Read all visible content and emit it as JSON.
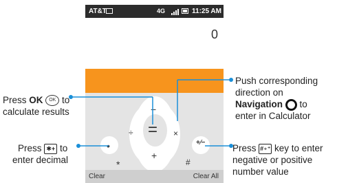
{
  "statusbar": {
    "carrier": "AT&T",
    "network": "4G",
    "time": "11:25 AM"
  },
  "display": {
    "value": "0"
  },
  "keypad": {
    "equals": "=",
    "minus": "−",
    "plus": "+",
    "divide": "÷",
    "multiply": "×",
    "dot": "•",
    "sign": "+∕−",
    "star": "*",
    "hash": "#",
    "soft_left": "Clear",
    "soft_right": "Clear All"
  },
  "callouts": {
    "ok": {
      "pre": "Press ",
      "key": "OK",
      "icon": "OK",
      "post": " to",
      "line2": "calculate results"
    },
    "decimal": {
      "pre": "Press ",
      "icon": "✱+",
      "post": " to",
      "line2": "enter decimal"
    },
    "nav": {
      "line1": "Push corresponding",
      "line2": "direction on",
      "bold": "Navigation",
      "post": " to",
      "line4": "enter in Calculator"
    },
    "sign": {
      "pre": "Press ",
      "icon": "#∘⁺",
      "post": " key to enter",
      "line2": "negative or positive",
      "line3": "number value"
    }
  },
  "colors": {
    "accent": "#f7941d",
    "callout_line": "#1a8fd8",
    "statusbar": "#2c2c2c"
  }
}
